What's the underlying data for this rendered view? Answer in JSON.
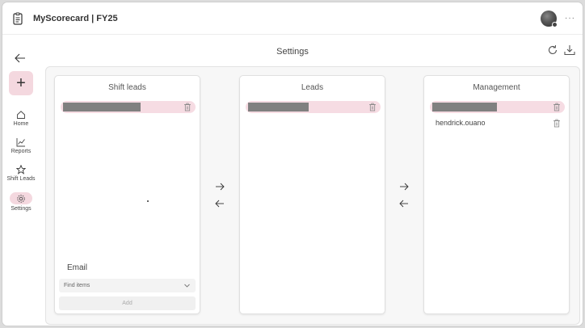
{
  "app": {
    "title": "MyScorecard | FY25",
    "more_label": "···"
  },
  "header": {
    "title": "Settings"
  },
  "sidebar": {
    "add_label": "+",
    "items": [
      {
        "label": "Home",
        "icon": "home-icon"
      },
      {
        "label": "Reports",
        "icon": "chart-icon"
      },
      {
        "label": "Shift Leads",
        "icon": "star-icon"
      },
      {
        "label": "Settings",
        "icon": "gear-icon",
        "active": true
      }
    ]
  },
  "panels": {
    "shift_leads": {
      "title": "Shift leads",
      "email_label": "Email",
      "find_placeholder": "Find items",
      "add_label": "Add"
    },
    "leads": {
      "title": "Leads"
    },
    "management": {
      "title": "Management",
      "second_item": "hendrick.ouano"
    }
  },
  "colors": {
    "accent": "#f4d8df",
    "redaction": "#808080"
  }
}
